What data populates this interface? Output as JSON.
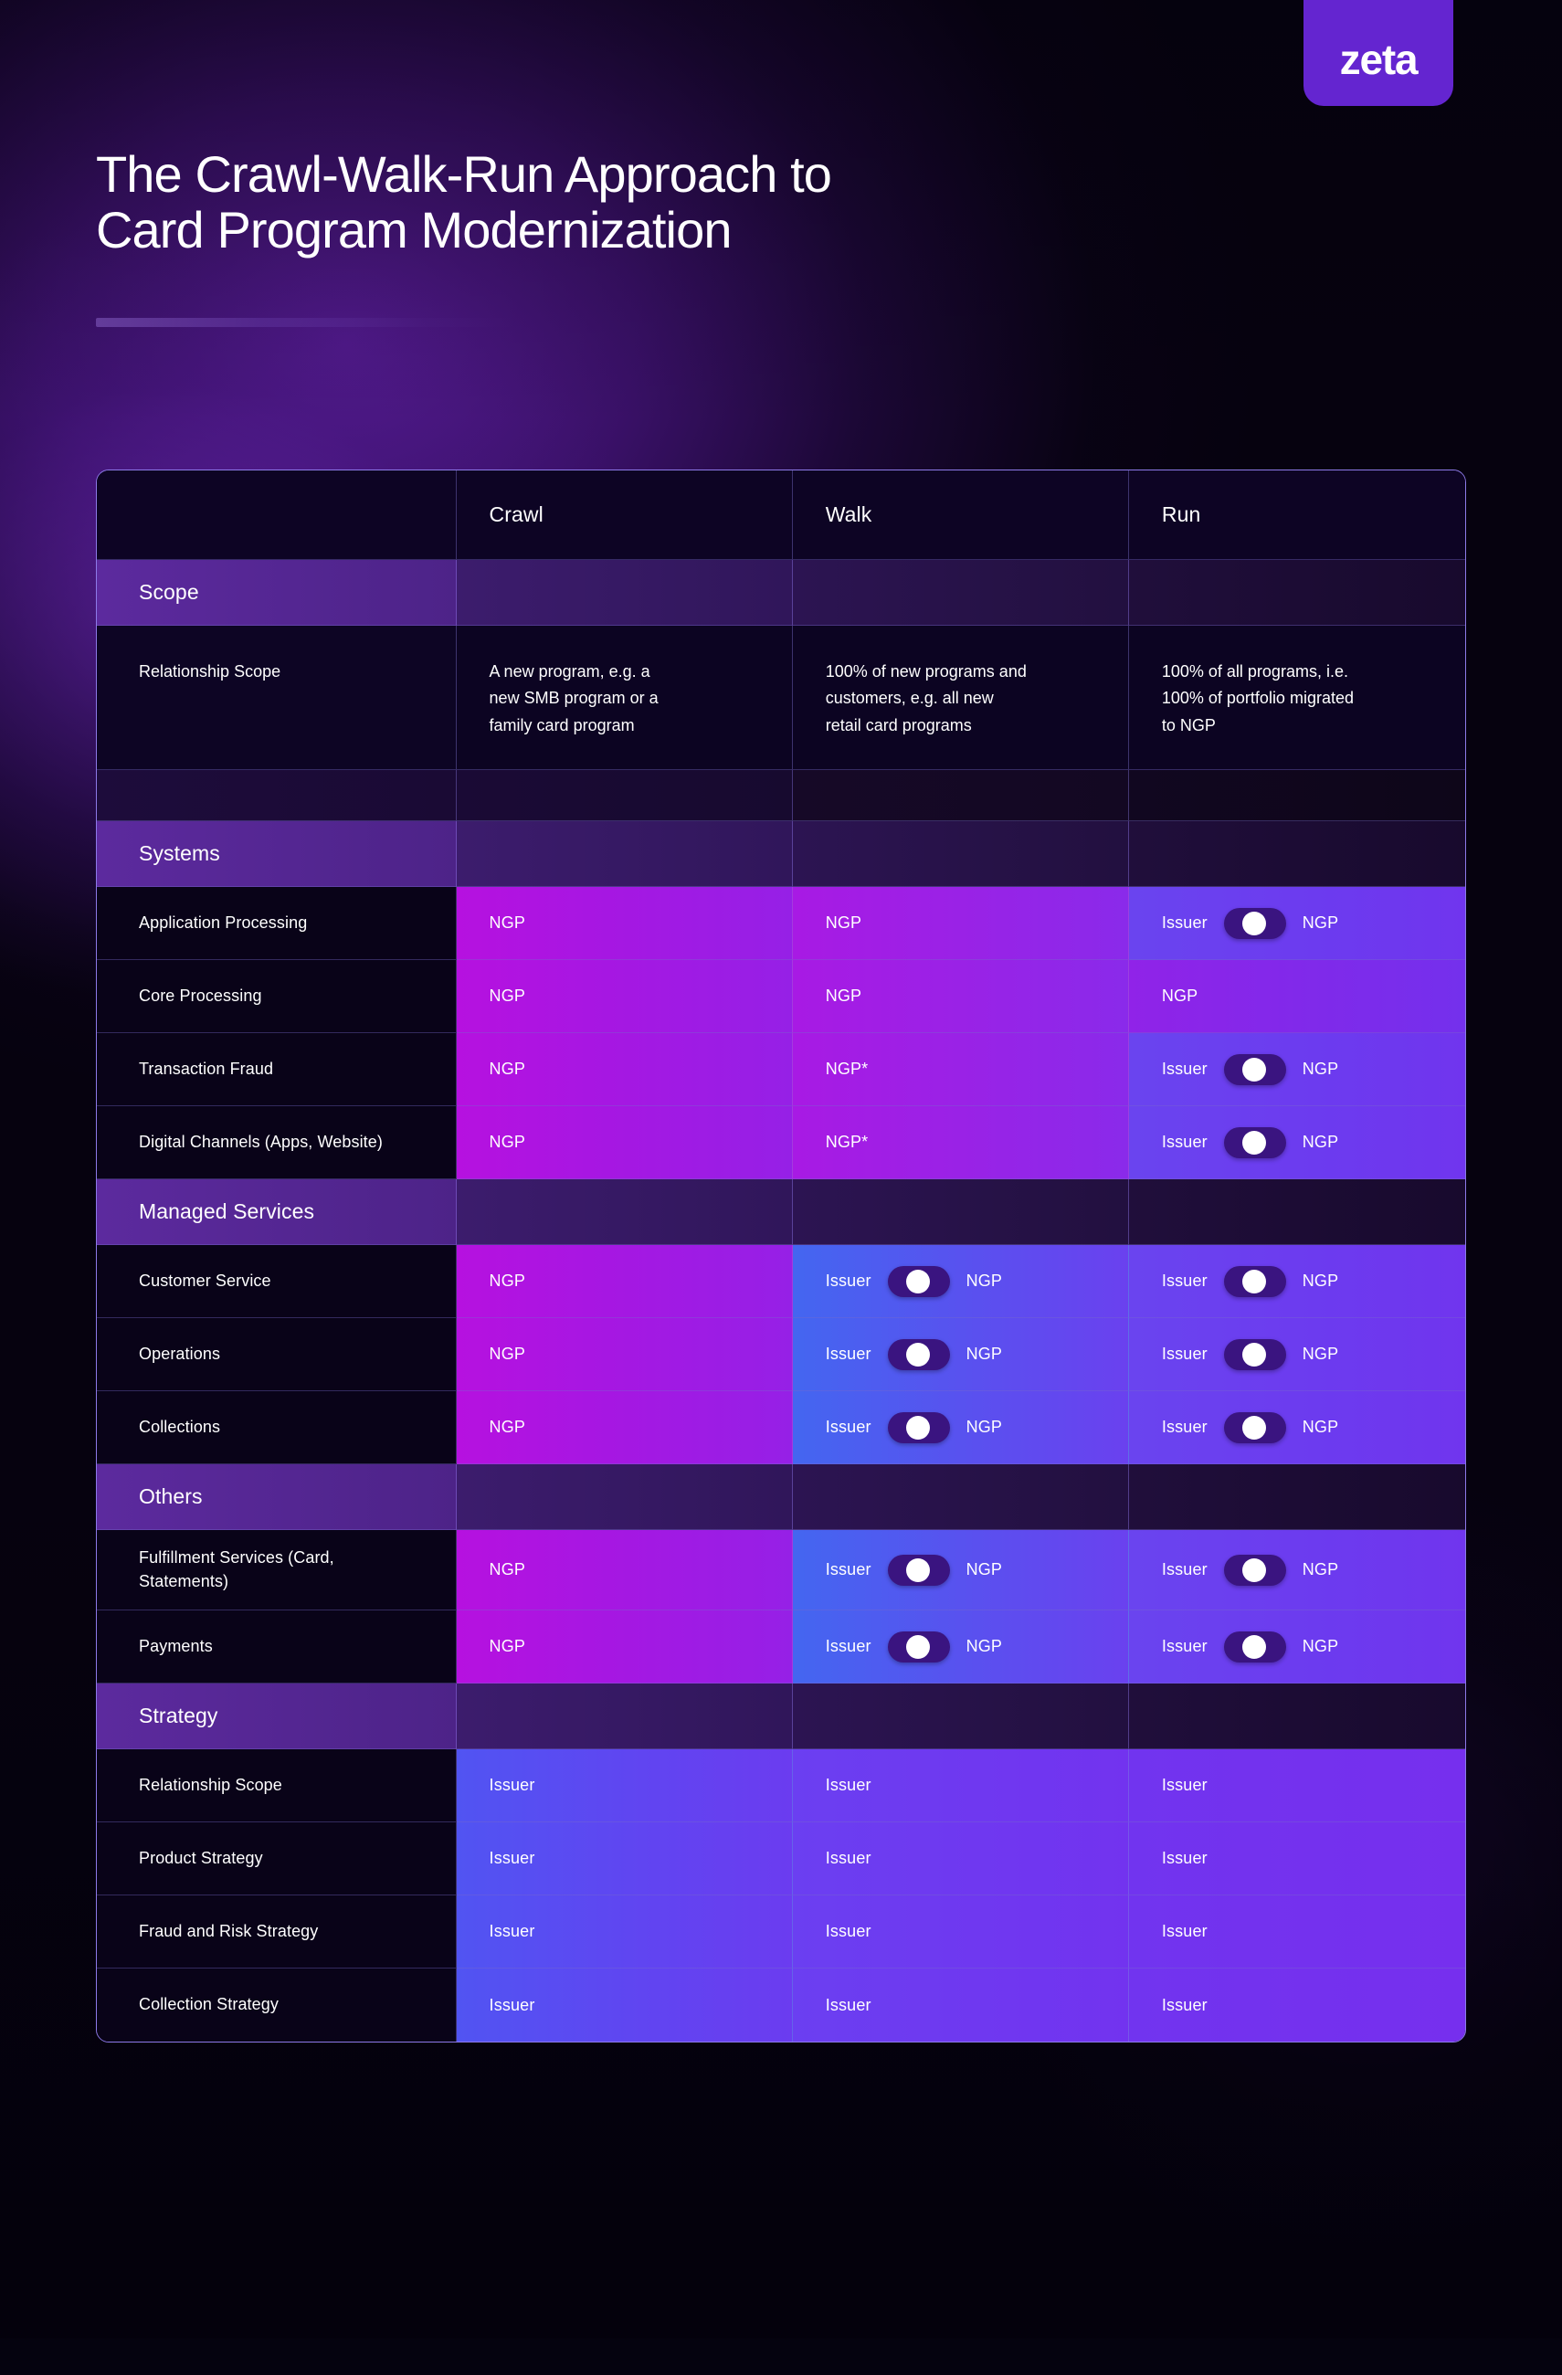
{
  "brand": {
    "logo_text": "zeta",
    "accent": "#6425d0"
  },
  "header": {
    "title": "The Crawl-Walk-Run Approach to\nCard Program Modernization"
  },
  "table": {
    "columns": [
      "",
      "Crawl",
      "Walk",
      "Run"
    ],
    "rows": [
      {
        "type": "header",
        "label": "",
        "cells": [
          "Crawl",
          "Walk",
          "Run"
        ]
      },
      {
        "type": "section",
        "label": "Scope"
      },
      {
        "type": "text",
        "label": "Relationship Scope",
        "cells": [
          "A new program, e.g. a\nnew SMB program or a\nfamily card program",
          "100% of new programs and\ncustomers, e.g. all new\nretail card programs",
          "100% of all programs, i.e.\n100% of portfolio migrated\nto NGP"
        ]
      },
      {
        "type": "spacer"
      },
      {
        "type": "section",
        "label": "Systems"
      },
      {
        "type": "data",
        "label": "Application Processing",
        "cells": [
          {
            "kind": "value",
            "text": "NGP"
          },
          {
            "kind": "value",
            "text": "NGP"
          },
          {
            "kind": "toggle",
            "left": "Issuer",
            "right": "NGP"
          }
        ]
      },
      {
        "type": "data",
        "label": "Core Processing",
        "cells": [
          {
            "kind": "value",
            "text": "NGP"
          },
          {
            "kind": "value",
            "text": "NGP"
          },
          {
            "kind": "value",
            "text": "NGP"
          }
        ]
      },
      {
        "type": "data",
        "label": "Transaction Fraud",
        "cells": [
          {
            "kind": "value",
            "text": "NGP"
          },
          {
            "kind": "value",
            "text": "NGP*"
          },
          {
            "kind": "toggle",
            "left": "Issuer",
            "right": "NGP"
          }
        ]
      },
      {
        "type": "data",
        "label": "Digital Channels (Apps, Website)",
        "cells": [
          {
            "kind": "value",
            "text": "NGP"
          },
          {
            "kind": "value",
            "text": "NGP*"
          },
          {
            "kind": "toggle",
            "left": "Issuer",
            "right": "NGP"
          }
        ]
      },
      {
        "type": "section",
        "label": "Managed Services"
      },
      {
        "type": "data",
        "label": "Customer Service",
        "cells": [
          {
            "kind": "value",
            "text": "NGP"
          },
          {
            "kind": "toggle",
            "left": "Issuer",
            "right": "NGP"
          },
          {
            "kind": "toggle",
            "left": "Issuer",
            "right": "NGP"
          }
        ]
      },
      {
        "type": "data",
        "label": "Operations",
        "cells": [
          {
            "kind": "value",
            "text": "NGP"
          },
          {
            "kind": "toggle",
            "left": "Issuer",
            "right": "NGP"
          },
          {
            "kind": "toggle",
            "left": "Issuer",
            "right": "NGP"
          }
        ]
      },
      {
        "type": "data",
        "label": "Collections",
        "cells": [
          {
            "kind": "value",
            "text": "NGP"
          },
          {
            "kind": "toggle",
            "left": "Issuer",
            "right": "NGP"
          },
          {
            "kind": "toggle",
            "left": "Issuer",
            "right": "NGP"
          }
        ]
      },
      {
        "type": "section",
        "label": "Others"
      },
      {
        "type": "data",
        "label": "Fulfillment Services (Card,\nStatements)",
        "cells": [
          {
            "kind": "value",
            "text": "NGP"
          },
          {
            "kind": "toggle",
            "left": "Issuer",
            "right": "NGP"
          },
          {
            "kind": "toggle",
            "left": "Issuer",
            "right": "NGP"
          }
        ]
      },
      {
        "type": "data",
        "label": "Payments",
        "cells": [
          {
            "kind": "value",
            "text": "NGP"
          },
          {
            "kind": "toggle",
            "left": "Issuer",
            "right": "NGP"
          },
          {
            "kind": "toggle",
            "left": "Issuer",
            "right": "NGP"
          }
        ]
      },
      {
        "type": "section",
        "label": "Strategy"
      },
      {
        "type": "data",
        "label": "Relationship Scope",
        "cells": [
          {
            "kind": "value",
            "text": "Issuer"
          },
          {
            "kind": "value",
            "text": "Issuer"
          },
          {
            "kind": "value",
            "text": "Issuer"
          }
        ]
      },
      {
        "type": "data",
        "label": "Product Strategy",
        "cells": [
          {
            "kind": "value",
            "text": "Issuer"
          },
          {
            "kind": "value",
            "text": "Issuer"
          },
          {
            "kind": "value",
            "text": "Issuer"
          }
        ]
      },
      {
        "type": "data",
        "label": "Fraud and Risk Strategy",
        "cells": [
          {
            "kind": "value",
            "text": "Issuer"
          },
          {
            "kind": "value",
            "text": "Issuer"
          },
          {
            "kind": "value",
            "text": "Issuer"
          }
        ]
      },
      {
        "type": "data",
        "label": "Collection Strategy",
        "cells": [
          {
            "kind": "value",
            "text": "Issuer"
          },
          {
            "kind": "value",
            "text": "Issuer"
          },
          {
            "kind": "value",
            "text": "Issuer"
          }
        ]
      }
    ]
  }
}
